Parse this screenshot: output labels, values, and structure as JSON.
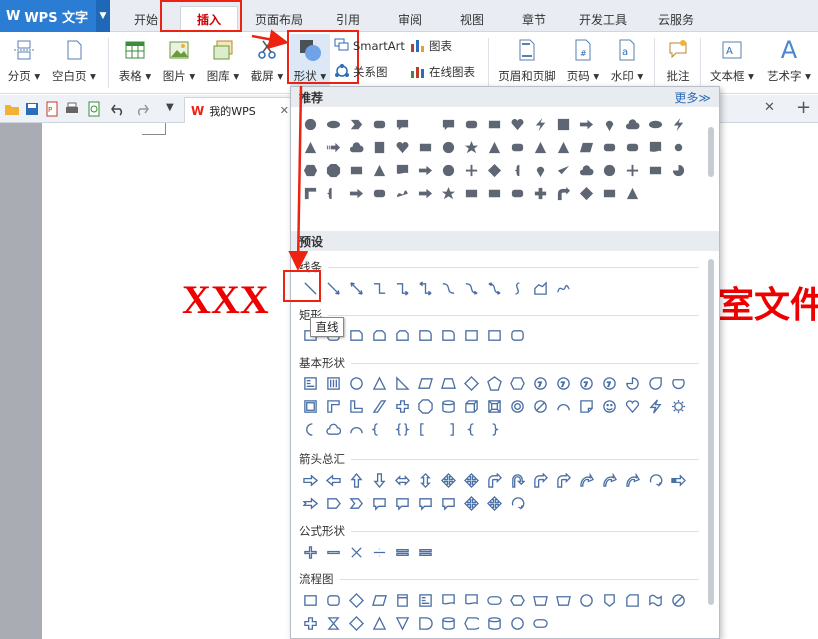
{
  "app": {
    "name": "WPS 文字"
  },
  "tabs": [
    "开始",
    "插入",
    "页面布局",
    "引用",
    "审阅",
    "视图",
    "章节",
    "开发工具",
    "云服务"
  ],
  "active_tab": "插入",
  "ribbon": {
    "page_break": "分页",
    "blank_page": "空白页",
    "table": "表格",
    "picture": "图片",
    "gallery": "图库",
    "screenshot": "截屏",
    "shape": "形状",
    "smartart": "SmartArt",
    "chart": "图表",
    "relation": "关系图",
    "online_chart": "在线图表",
    "header_footer": "页眉和页脚",
    "page_number": "页码",
    "watermark": "水印",
    "comment": "批注",
    "textbox": "文本框",
    "wordart": "艺术字"
  },
  "doc_tab": {
    "label": "我的WPS"
  },
  "document": {
    "text_left": "XXX",
    "text_right": "室文件"
  },
  "shapes_panel": {
    "recommended": "推荐",
    "more": "更多≫",
    "preset": "预设",
    "lines": "线条",
    "rectangles": "矩形",
    "basic": "基本形状",
    "arrows": "箭头总汇",
    "formula": "公式形状",
    "flowchart": "流程图",
    "tooltip": "直线"
  },
  "colors": {
    "accent": "#2b7cd3",
    "highlight": "#e21111",
    "doc_text": "#e00000"
  }
}
